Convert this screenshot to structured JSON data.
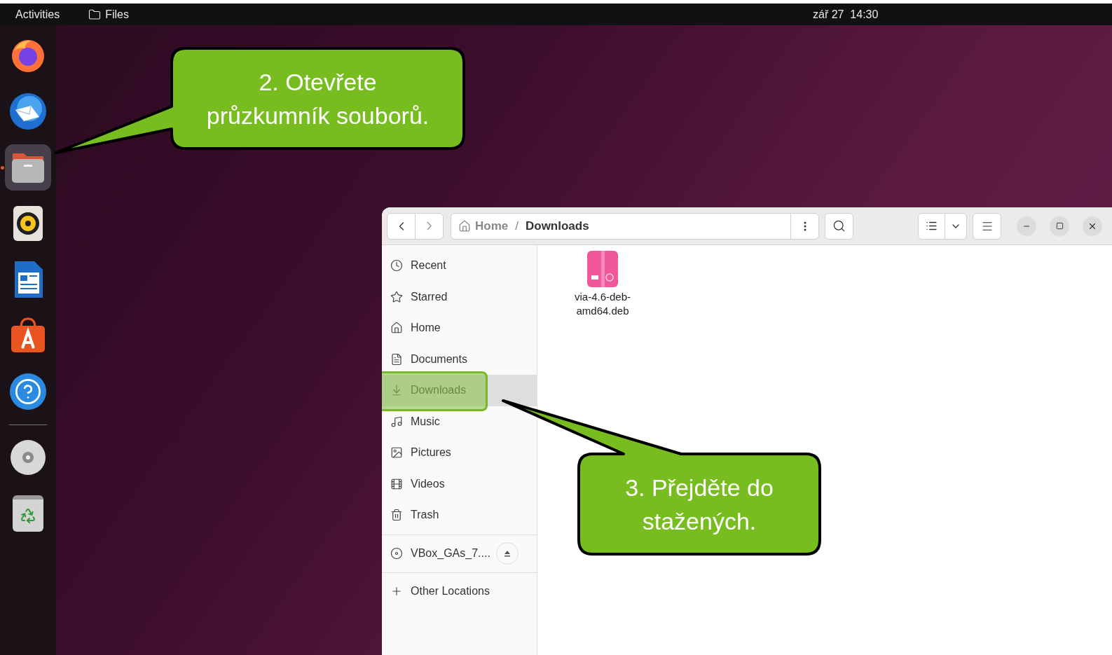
{
  "top_bar": {
    "activities": "Activities",
    "app": "Files",
    "clock": "zář 27  14:30"
  },
  "dock": {
    "items": [
      {
        "kind": "firefox",
        "selected": false,
        "running": false
      },
      {
        "kind": "thunderbird",
        "selected": false,
        "running": false
      },
      {
        "kind": "files",
        "selected": true,
        "running": true
      },
      {
        "kind": "rhythmbox",
        "selected": false,
        "running": false
      },
      {
        "kind": "writer",
        "selected": false,
        "running": false
      },
      {
        "kind": "appcenter",
        "selected": false,
        "running": false
      },
      {
        "kind": "help",
        "selected": false,
        "running": false
      },
      {
        "kind": "separator"
      },
      {
        "kind": "disc",
        "selected": false,
        "running": false
      },
      {
        "kind": "trash",
        "selected": false,
        "running": false
      }
    ]
  },
  "window": {
    "path": [
      {
        "label": "Home",
        "current": false
      },
      {
        "label": "Downloads",
        "current": true
      }
    ],
    "path_separator": "/",
    "sidebar": {
      "places": [
        {
          "label": "Recent",
          "selected": false,
          "highlighted": false
        },
        {
          "label": "Starred",
          "selected": false,
          "highlighted": false
        },
        {
          "label": "Home",
          "selected": false,
          "highlighted": false
        },
        {
          "label": "Documents",
          "selected": false,
          "highlighted": false
        },
        {
          "label": "Downloads",
          "selected": true,
          "highlighted": true
        },
        {
          "label": "Music",
          "selected": false,
          "highlighted": false
        },
        {
          "label": "Pictures",
          "selected": false,
          "highlighted": false
        },
        {
          "label": "Videos",
          "selected": false,
          "highlighted": false
        },
        {
          "label": "Trash",
          "selected": false,
          "highlighted": false
        }
      ],
      "devices": [
        {
          "label": "VBox_GAs_7...."
        }
      ],
      "other_locations": "Other Locations"
    },
    "files": [
      {
        "name": "via-4.6-deb-amd64.deb"
      }
    ]
  },
  "callouts": [
    {
      "text": "2. Otevřete průzkumník souborů."
    },
    {
      "text": "3. Přejděte do stažených."
    }
  ]
}
